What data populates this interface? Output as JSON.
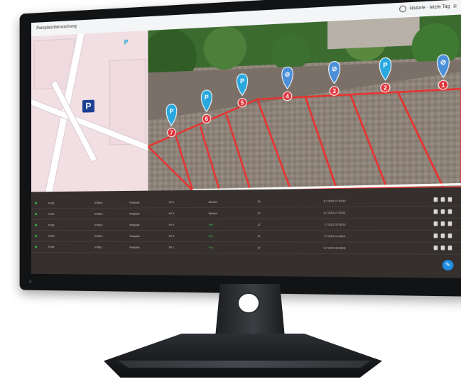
{
  "app": {
    "title": "Parkplatzüberwachung",
    "header_right_label": "Historie · letzte Tag",
    "menu_glyph": "≡",
    "clock_icon": "clock-icon"
  },
  "map": {
    "parking_symbol": "P",
    "small_parking_symbol": "P",
    "accent_color": "#1d3f93"
  },
  "aerial": {
    "spots": [
      {
        "number": "1",
        "status": "occupied"
      },
      {
        "number": "2",
        "status": "free"
      },
      {
        "number": "3",
        "status": "occupied"
      },
      {
        "number": "4",
        "status": "occupied"
      },
      {
        "number": "5",
        "status": "free"
      },
      {
        "number": "6",
        "status": "free"
      },
      {
        "number": "7",
        "status": "free"
      }
    ],
    "free_color": "#29a8e0",
    "occupied_color": "#e0343b"
  },
  "table": {
    "rows": [
      {
        "c1": "PO0E",
        "c2": "STBB.0",
        "c3": "Parkplatz",
        "c4": "SP 0",
        "c5": "Besetzt",
        "c6": "13",
        "c7": "8.7.2021 17:43:43"
      },
      {
        "c1": "PO0E",
        "c2": "STBB.0",
        "c3": "Parkplatz",
        "c4": "SP 0",
        "c5": "Besetzt",
        "c6": "12",
        "c7": "8.7.2021 17:16:31"
      },
      {
        "c1": "PO0E",
        "c2": "STBB.0",
        "c3": "Parkplatz",
        "c4": "SP 0",
        "c5": "Frei",
        "c6": "12",
        "c7": "7.7.2021 10:38:13"
      },
      {
        "c1": "PO0E",
        "c2": "STBB.0",
        "c3": "Parkplatz",
        "c4": "SP 0",
        "c5": "Frei",
        "c6": "12",
        "c7": "7.7.2021 10:38:01"
      },
      {
        "c1": "PO0E",
        "c2": "STBB.1",
        "c3": "Parkplatz",
        "c4": "SP 1",
        "c5": "Frei",
        "c6": "12",
        "c7": "6.7.2021 08:35:06"
      }
    ],
    "fab_glyph": "✎"
  }
}
